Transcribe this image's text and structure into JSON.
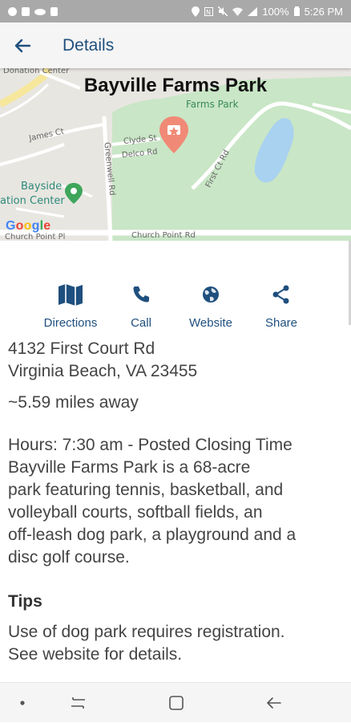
{
  "status_bar": {
    "battery": "100%",
    "time": "5:26 PM"
  },
  "app_bar": {
    "title": "Details"
  },
  "map": {
    "title": "Bayville Farms Park",
    "labels": {
      "donation_center": "Donation Center",
      "farms_park": "Farms Park",
      "james_ct": "James Ct",
      "clyde_st": "Clyde St",
      "delco_rd": "Delco Rd",
      "greenwell_rd": "Greenwell Rd",
      "first_ct_rd": "First Ct Rd",
      "bayside": "Bayside",
      "ation_center": "ation Center",
      "church_point_pl": "Church Point Pl",
      "church_point_rd": "Church Point Rd"
    },
    "attribution": [
      "G",
      "o",
      "o",
      "g",
      "l",
      "e"
    ],
    "colors": {
      "park": "#c9e6c6",
      "water": "#a9d2f0",
      "road": "#ffffff",
      "marker": "#f08a76",
      "base": "#e8e6e1"
    }
  },
  "actions": {
    "directions": {
      "label": "Directions",
      "icon": "map-icon"
    },
    "call": {
      "label": "Call",
      "icon": "phone-icon"
    },
    "website": {
      "label": "Website",
      "icon": "globe-icon"
    },
    "share": {
      "label": "Share",
      "icon": "share-icon"
    }
  },
  "details": {
    "address_line1": "4132 First Court Rd",
    "address_line2": "Virginia Beach, VA 23455",
    "distance": "~5.59 miles away",
    "hours": "Hours: 7:30 am - Posted Closing Time",
    "description_lines": [
      "Bayville Farms Park is a 68-acre",
      "park featuring tennis, basketball, and",
      "volleyball courts, softball fields, an",
      "off-leash dog park, a playground and a",
      "disc golf course."
    ],
    "tips_heading": "Tips",
    "tips_lines": [
      "Use of dog park requires registration.",
      "See website for details."
    ]
  },
  "theme": {
    "accent": "#1f4f7e",
    "text": "#444444",
    "status_bar": "#a9a9a9"
  },
  "nav_bar": {
    "buttons": [
      "dot-icon",
      "recents-icon",
      "home-icon",
      "back-icon"
    ]
  }
}
